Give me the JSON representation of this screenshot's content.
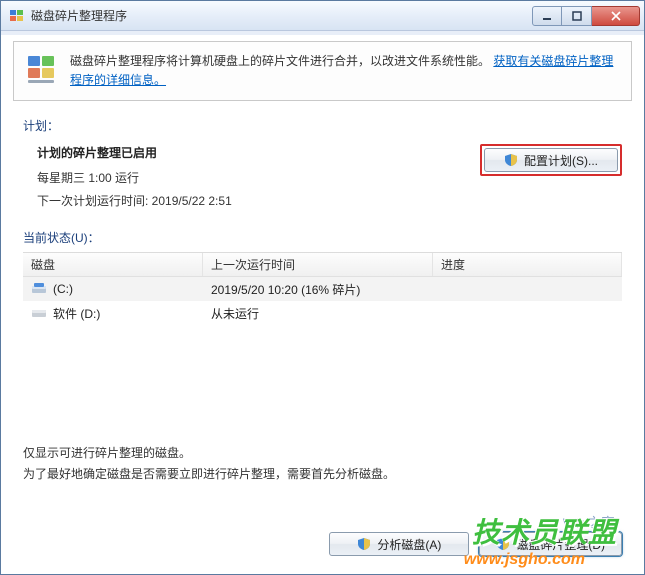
{
  "window": {
    "title": "磁盘碎片整理程序"
  },
  "banner": {
    "text_prefix": "磁盘碎片整理程序将计算机硬盘上的碎片文件进行合并，以改进文件系统性能。",
    "link": "获取有关磁盘碎片整理程序的详细信息。"
  },
  "plan": {
    "section_label": "计划：",
    "title": "计划的碎片整理已启用",
    "schedule": "每星期三   1:00 运行",
    "next_run": "下一次计划运行时间: 2019/5/22 2:51",
    "config_button": "配置计划(S)..."
  },
  "status": {
    "section_label": "当前状态(U)："
  },
  "table": {
    "headers": {
      "disk": "磁盘",
      "last": "上一次运行时间",
      "progress": "进度"
    },
    "rows": [
      {
        "disk": "(C:)",
        "last": "2019/5/20 10:20 (16% 碎片)",
        "progress": "",
        "icon": "c"
      },
      {
        "disk": "软件 (D:)",
        "last": "从未运行",
        "progress": "",
        "icon": "d"
      }
    ]
  },
  "hint": {
    "line1": "仅显示可进行碎片整理的磁盘。",
    "line2": "为了最好地确定磁盘是否需要立即进行碎片整理，需要首先分析磁盘。"
  },
  "footer": {
    "analyze": "分析磁盘(A)",
    "defrag": "磁盘碎片整理(D)"
  },
  "watermark": {
    "brand": "技术员联盟",
    "url": "www.jsgho.com",
    "winhome": "Win之家"
  }
}
